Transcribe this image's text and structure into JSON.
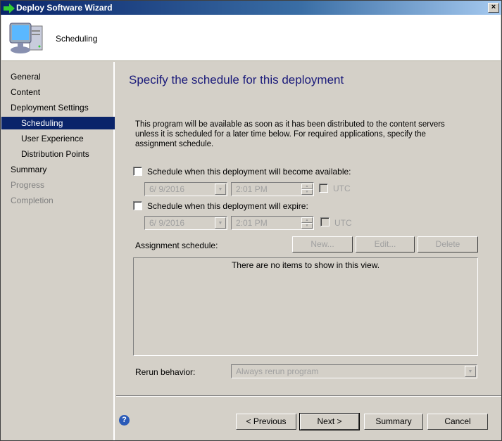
{
  "window": {
    "title": "Deploy Software Wizard",
    "close": "×"
  },
  "header": {
    "page": "Scheduling",
    "icon": "computer-icon"
  },
  "sidebar": {
    "items": [
      {
        "label": "General",
        "state": "normal",
        "sub": false
      },
      {
        "label": "Content",
        "state": "normal",
        "sub": false
      },
      {
        "label": "Deployment Settings",
        "state": "normal",
        "sub": false
      },
      {
        "label": "Scheduling",
        "state": "selected",
        "sub": true
      },
      {
        "label": "User Experience",
        "state": "normal",
        "sub": true
      },
      {
        "label": "Distribution Points",
        "state": "normal",
        "sub": true
      },
      {
        "label": "Summary",
        "state": "normal",
        "sub": false
      },
      {
        "label": "Progress",
        "state": "disabled",
        "sub": false
      },
      {
        "label": "Completion",
        "state": "disabled",
        "sub": false
      }
    ]
  },
  "main": {
    "heading": "Specify the schedule for this deployment",
    "description": "This program will be available as soon as it has been distributed to the content servers unless it is scheduled for a later time below. For required applications, specify the assignment schedule.",
    "available": {
      "label": "Schedule when this deployment will become available:",
      "checked": false,
      "date": "6/  9/2016",
      "time": "2:01 PM",
      "utc": "UTC"
    },
    "expire": {
      "label": "Schedule when this deployment will expire:",
      "checked": false,
      "date": "6/  9/2016",
      "time": "2:01 PM",
      "utc": "UTC"
    },
    "assignment": {
      "label": "Assignment schedule:",
      "new": "New...",
      "edit": "Edit...",
      "delete": "Delete",
      "empty": "There are no items to show in this view."
    },
    "rerun": {
      "label": "Rerun behavior:",
      "value": "Always rerun program"
    }
  },
  "footer": {
    "previous": "< Previous",
    "next": "Next >",
    "summary": "Summary",
    "cancel": "Cancel",
    "help": "?"
  }
}
